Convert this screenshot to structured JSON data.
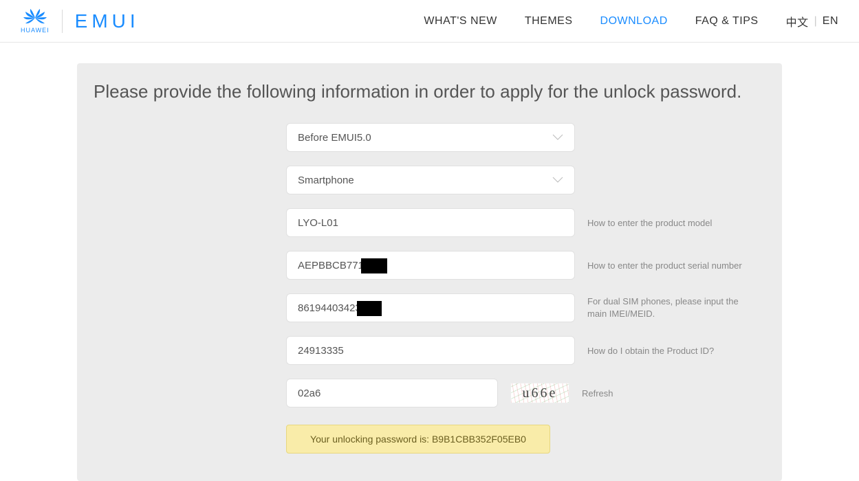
{
  "brand": {
    "huawei": "HUAWEI",
    "emui": "EMUI"
  },
  "nav": {
    "whats_new": "WHAT'S NEW",
    "themes": "THEMES",
    "download": "DOWNLOAD",
    "faq": "FAQ & TIPS"
  },
  "lang": {
    "zh": "中文",
    "en": "EN"
  },
  "title": "Please provide the following information in order to apply for the unlock password.",
  "form": {
    "emui_version": "Before EMUI5.0",
    "device_type": "Smartphone",
    "model": "LYO-L01",
    "serial": "AEPBBCB7712",
    "imei": "86194403423",
    "product_id": "24913335",
    "captcha_input": "02a6",
    "captcha_text": "u66e"
  },
  "hints": {
    "model": "How to enter the product model",
    "serial": "How to enter the product serial number",
    "imei": "For dual SIM phones, please input the main IMEI/MEID.",
    "product_id": "How do I obtain the Product ID?",
    "refresh": "Refresh"
  },
  "result": "Your unlocking password is: B9B1CBB352F05EB0"
}
